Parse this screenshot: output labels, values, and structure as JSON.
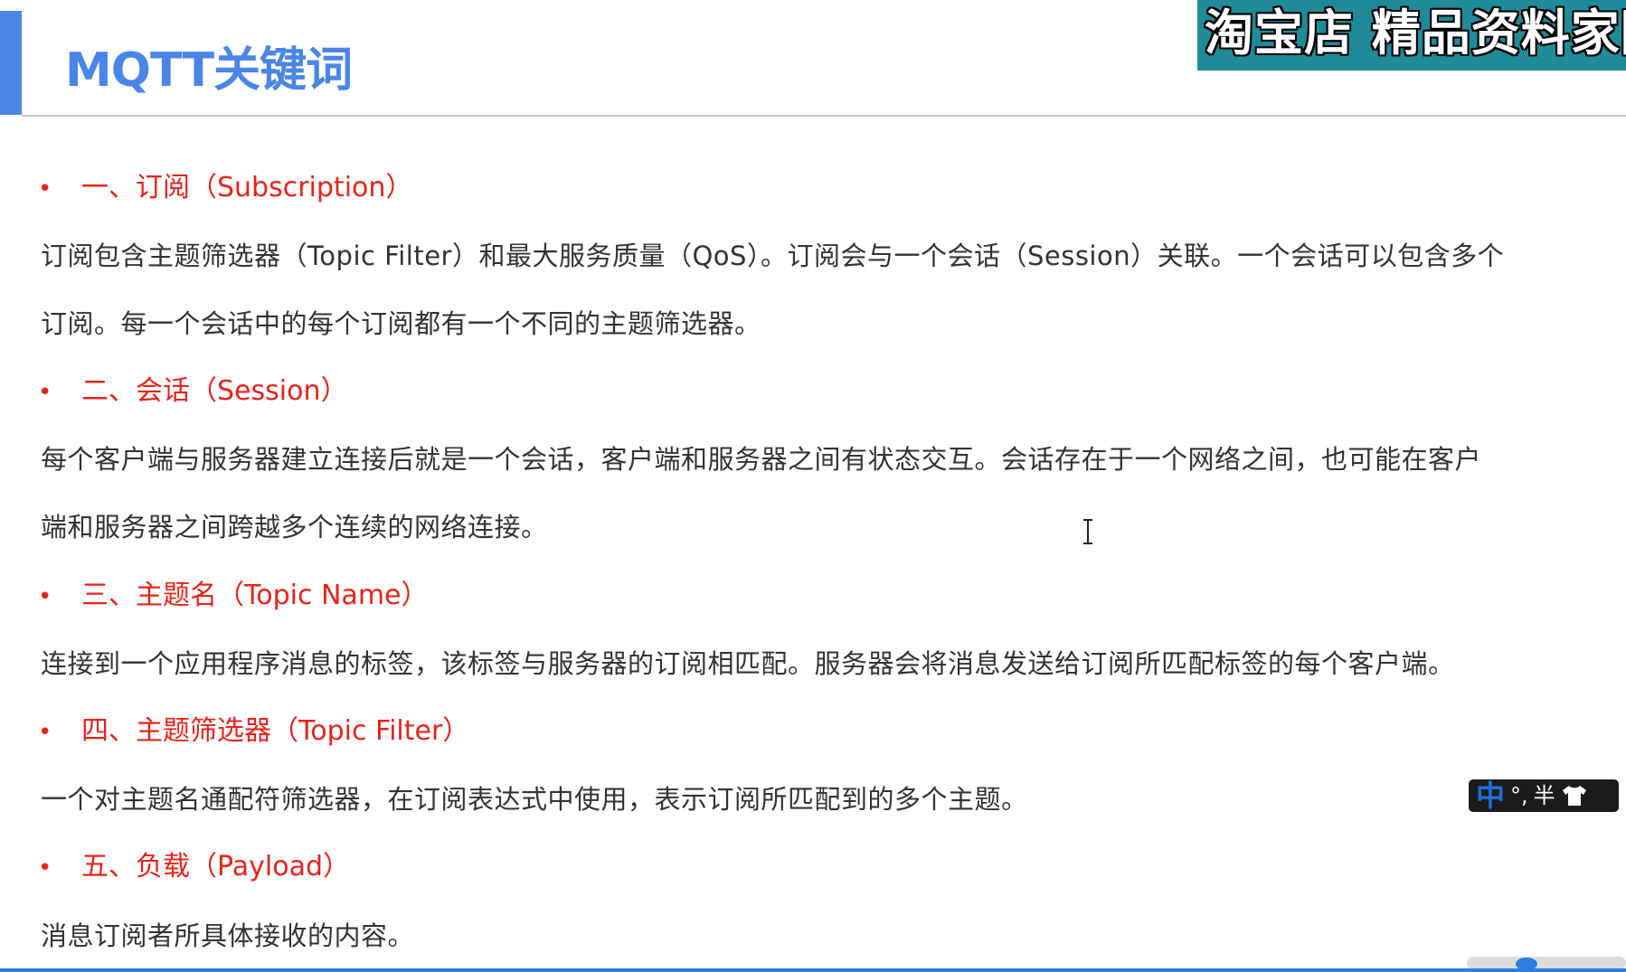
{
  "slide": {
    "title": "MQTT关键词"
  },
  "watermark": {
    "text": "淘宝店 精品资料家园"
  },
  "sections": [
    {
      "bullet": "•",
      "heading": "一、订阅（Subscription）",
      "lines": [
        "订阅包含主题筛选器（Topic Filter）和最大服务质量（QoS）。订阅会与一个会话（Session）关联。一个会话可以包含多个",
        "订阅。每一个会话中的每个订阅都有一个不同的主题筛选器。"
      ]
    },
    {
      "bullet": "•",
      "heading": "二、会话（Session）",
      "lines": [
        "每个客户端与服务器建立连接后就是一个会话，客户端和服务器之间有状态交互。会话存在于一个网络之间，也可能在客户",
        "端和服务器之间跨越多个连续的网络连接。"
      ]
    },
    {
      "bullet": "•",
      "heading": "三、主题名（Topic Name）",
      "lines": [
        "连接到一个应用程序消息的标签，该标签与服务器的订阅相匹配。服务器会将消息发送给订阅所匹配标签的每个客户端。"
      ]
    },
    {
      "bullet": "•",
      "heading": "四、主题筛选器（Topic Filter）",
      "lines": [
        "一个对主题名通配符筛选器，在订阅表达式中使用，表示订阅所匹配到的多个主题。"
      ]
    },
    {
      "bullet": "•",
      "heading": "五、负载（Payload）",
      "lines": [
        "消息订阅者所具体接收的内容。"
      ]
    }
  ],
  "ime": {
    "mode": "中",
    "punct": "°,",
    "width": "半",
    "skin_icon": "shirt-icon"
  },
  "colors": {
    "title": "#4a86e8",
    "heading": "#e8231a",
    "body": "#333333",
    "banner": "#1f8a98"
  }
}
